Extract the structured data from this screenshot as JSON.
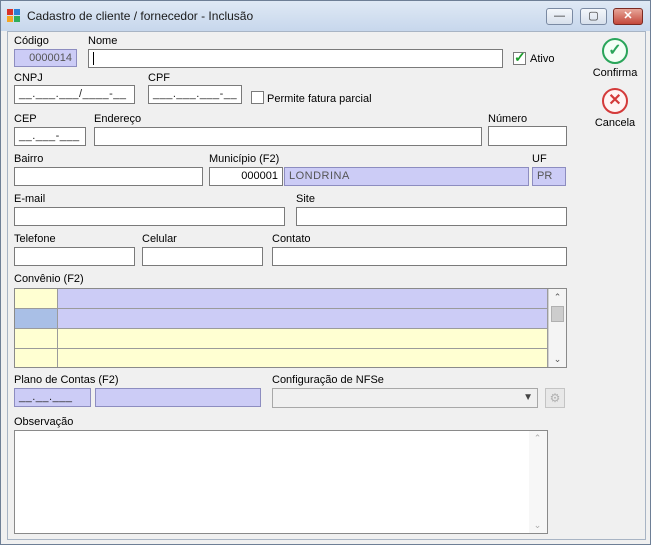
{
  "window": {
    "title": "Cadastro de cliente / fornecedor - Inclusão",
    "minimize_glyph": "—",
    "maximize_glyph": "▢",
    "close_glyph": "✕",
    "app_icon_colors": [
      "#d8312a",
      "#2c7fd6",
      "#f5a623",
      "#2fae5a"
    ]
  },
  "actions": {
    "confirm_label": "Confirma",
    "confirm_icon": "check-icon",
    "confirm_glyph": "✓",
    "cancel_label": "Cancela",
    "cancel_icon": "x-icon",
    "cancel_glyph": "✕"
  },
  "form": {
    "codigo": {
      "label": "Código",
      "value": "0000014"
    },
    "nome": {
      "label": "Nome",
      "value": ""
    },
    "ativo": {
      "label": "Ativo",
      "checked": true,
      "mark": "✓"
    },
    "cnpj": {
      "label": "CNPJ",
      "value": "__.___.___/____-__"
    },
    "cpf": {
      "label": "CPF",
      "value": "___.___.___-__"
    },
    "fatura_parcial": {
      "label": "Permite fatura parcial",
      "checked": false
    },
    "cep": {
      "label": "CEP",
      "value": "__.___-___"
    },
    "endereco": {
      "label": "Endereço",
      "value": ""
    },
    "numero": {
      "label": "Número",
      "value": ""
    },
    "bairro": {
      "label": "Bairro",
      "value": ""
    },
    "municipio": {
      "label": "Município (F2)",
      "code": "000001",
      "name": "LONDRINA"
    },
    "uf": {
      "label": "UF",
      "value": "PR"
    },
    "email": {
      "label": "E-mail",
      "value": ""
    },
    "site": {
      "label": "Site",
      "value": ""
    },
    "telefone": {
      "label": "Telefone",
      "value": ""
    },
    "celular": {
      "label": "Celular",
      "value": ""
    },
    "contato": {
      "label": "Contato",
      "value": ""
    },
    "convenio": {
      "label": "Convênio (F2)"
    },
    "plano_contas": {
      "label": "Plano de Contas (F2)",
      "code": "__.__.___",
      "name": ""
    },
    "nfse": {
      "label": "Configuração de NFSe",
      "value": "",
      "gear_glyph": "⚙"
    },
    "observacao": {
      "label": "Observação",
      "value": ""
    }
  },
  "scroll": {
    "up": "▲",
    "down": "▼",
    "up_chevron": "⌃",
    "down_chevron": "⌄"
  },
  "colors": {
    "readonly_bg": "#ccccf6",
    "grid_yellow": "#ffffd2",
    "grid_blue": "#ccccf6",
    "grid_selected": "#a9bfe6"
  }
}
